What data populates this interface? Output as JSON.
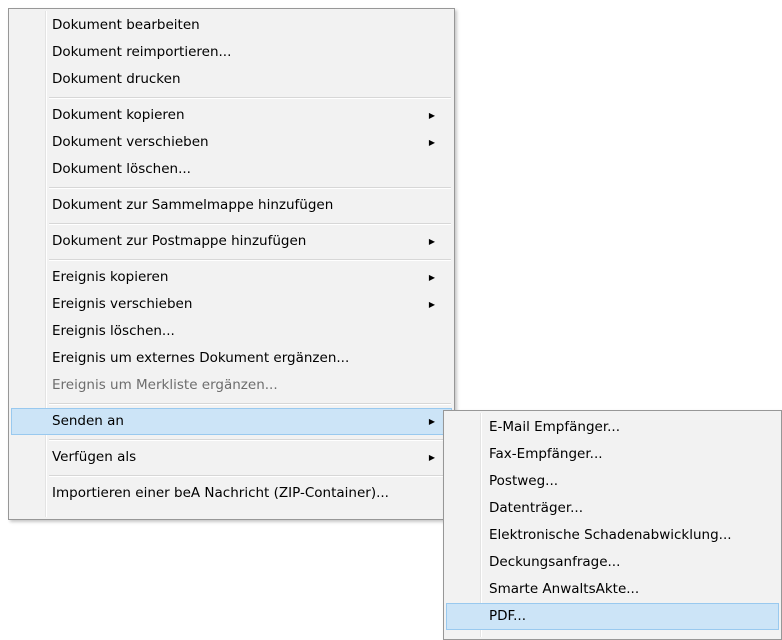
{
  "context_menu": {
    "groups": [
      [
        {
          "label": "Dokument bearbeiten"
        },
        {
          "label": "Dokument reimportieren..."
        },
        {
          "label": "Dokument drucken"
        }
      ],
      [
        {
          "label": "Dokument kopieren",
          "submenu": true
        },
        {
          "label": "Dokument verschieben",
          "submenu": true
        },
        {
          "label": "Dokument löschen..."
        }
      ],
      [
        {
          "label": "Dokument zur Sammelmappe hinzufügen"
        }
      ],
      [
        {
          "label": "Dokument zur Postmappe hinzufügen",
          "submenu": true
        }
      ],
      [
        {
          "label": "Ereignis kopieren",
          "submenu": true
        },
        {
          "label": "Ereignis verschieben",
          "submenu": true
        },
        {
          "label": "Ereignis löschen..."
        },
        {
          "label": "Ereignis um externes Dokument ergänzen..."
        },
        {
          "label": "Ereignis um Merkliste ergänzen...",
          "disabled": true
        }
      ],
      [
        {
          "label": "Senden an",
          "submenu": true,
          "highlighted": true
        }
      ],
      [
        {
          "label": "Verfügen als",
          "submenu": true
        }
      ],
      [
        {
          "label": "Importieren einer beA Nachricht (ZIP-Container)..."
        }
      ]
    ]
  },
  "senden_an_submenu": {
    "items": [
      {
        "label": "E-Mail Empfänger..."
      },
      {
        "label": "Fax-Empfänger..."
      },
      {
        "label": "Postweg..."
      },
      {
        "label": "Datenträger..."
      },
      {
        "label": "Elektronische Schadenabwicklung..."
      },
      {
        "label": "Deckungsanfrage..."
      },
      {
        "label": "Smarte AnwaltsAkte..."
      },
      {
        "label": "PDF...",
        "highlighted": true
      }
    ]
  },
  "icons": {
    "submenu_arrow": "submenu-arrow-icon",
    "submenu_arrow_glyph": "▶"
  },
  "colors": {
    "menu_background": "#f2f2f2",
    "menu_border": "#979797",
    "highlight_background": "#cce4f7",
    "highlight_border": "#99c9ef",
    "disabled_text": "#6d6d6d"
  }
}
